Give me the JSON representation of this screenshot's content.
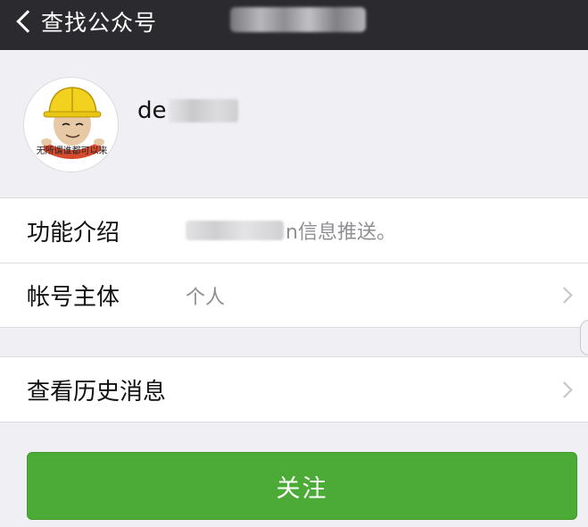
{
  "nav": {
    "back_label": "查找公众号"
  },
  "account": {
    "name_prefix": "de",
    "avatar_caption": "无所谓谁都可以来"
  },
  "details": {
    "intro_label": "功能介绍",
    "intro_value_suffix": "n信息推送。",
    "subject_label": "帐号主体",
    "subject_value": "个人"
  },
  "history": {
    "label": "查看历史消息"
  },
  "follow_button": {
    "label": "关注",
    "color": "#4cab37"
  },
  "colors": {
    "nav_bg": "#2b2b2f",
    "page_bg": "#efeff4",
    "secondary_text": "#8e8e93"
  }
}
